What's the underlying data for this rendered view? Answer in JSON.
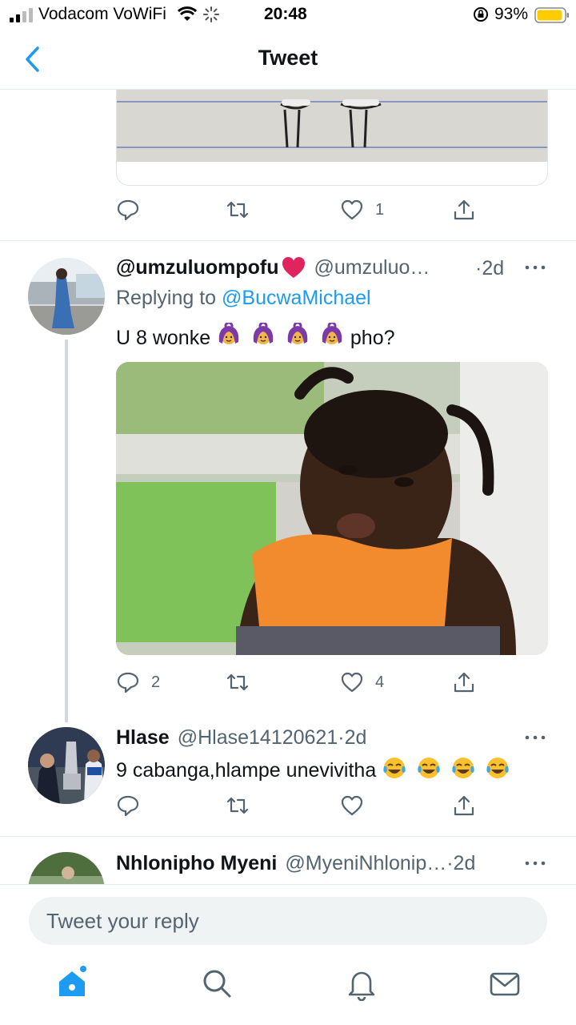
{
  "status_bar": {
    "carrier": "Vodacom VoWiFi",
    "time": "20:48",
    "battery": "93%"
  },
  "header": {
    "title": "Tweet",
    "back_icon": "chevron-left-icon"
  },
  "tweet_top": {
    "actions": {
      "reply": "",
      "retweet": "",
      "like": "1"
    }
  },
  "tweet_main": {
    "name": "@umzuluompofu",
    "name_emoji": "red-heart",
    "handle": "@umzuluo…",
    "time": "·2d",
    "replying_prefix": "Replying to",
    "replying_to": "@BucwaMichael",
    "text_before": "U 8 wonke",
    "text_after": "pho?",
    "emoji": "woman-gesturing-ok",
    "actions": {
      "reply": "2",
      "retweet": "",
      "like": "4"
    }
  },
  "tweet_reply": {
    "name": "Hlase",
    "handle": "@Hlase14120621",
    "time": "·2d",
    "text": "9 cabanga,hlampe unevivitha",
    "emoji": "face-with-tears-of-joy"
  },
  "tweet_next": {
    "name": "Nhlonipho Myeni",
    "handle": "@MyeniNhlonip…",
    "time": "·2d"
  },
  "composer": {
    "placeholder": "Tweet your reply"
  },
  "colors": {
    "accent": "#1d9bf0",
    "secondary_text": "#536471",
    "battery": "#ffcc00",
    "heart": "#e0245e"
  }
}
